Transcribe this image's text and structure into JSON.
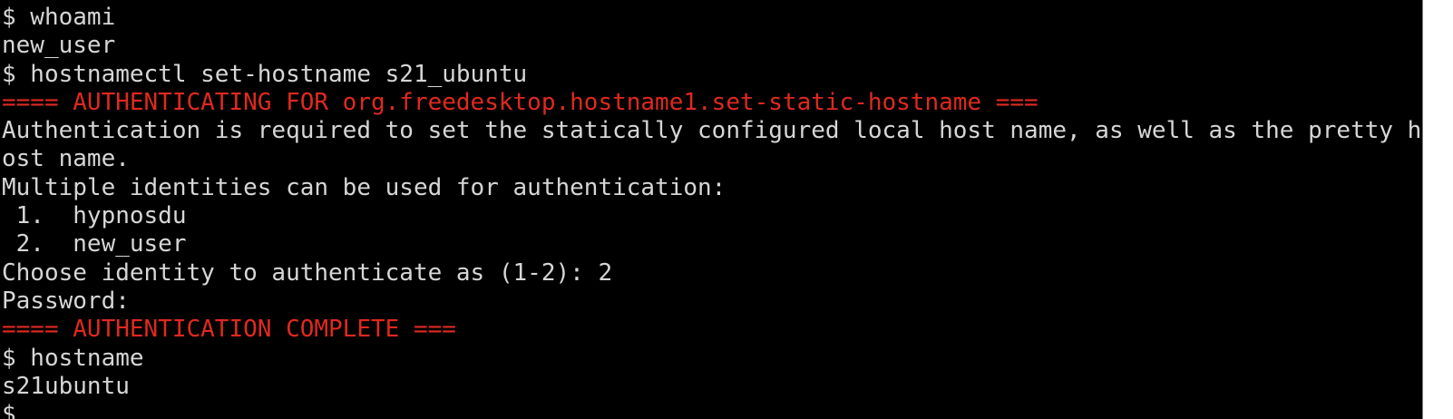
{
  "terminal": {
    "colors": {
      "background": "#000000",
      "foreground": "#d6d6d6",
      "error": "#e0291f"
    },
    "lines": [
      {
        "text": "$ whoami",
        "style": "normal"
      },
      {
        "text": "new_user",
        "style": "normal"
      },
      {
        "text": "$ hostnamectl set-hostname s21_ubuntu",
        "style": "normal"
      },
      {
        "text": "==== AUTHENTICATING FOR org.freedesktop.hostname1.set-static-hostname ===",
        "style": "red"
      },
      {
        "text": "Authentication is required to set the statically configured local host name, as well as the pretty h",
        "style": "normal"
      },
      {
        "text": "ost name.",
        "style": "normal"
      },
      {
        "text": "Multiple identities can be used for authentication:",
        "style": "normal"
      },
      {
        "text": " 1.  hypnosdu",
        "style": "normal"
      },
      {
        "text": " 2.  new_user",
        "style": "normal"
      },
      {
        "text": "Choose identity to authenticate as (1-2): 2",
        "style": "normal"
      },
      {
        "text": "Password:",
        "style": "normal"
      },
      {
        "text": "==== AUTHENTICATION COMPLETE ===",
        "style": "red"
      },
      {
        "text": "$ hostname",
        "style": "normal"
      },
      {
        "text": "s21ubuntu",
        "style": "normal"
      },
      {
        "text": "$",
        "style": "normal"
      }
    ]
  }
}
